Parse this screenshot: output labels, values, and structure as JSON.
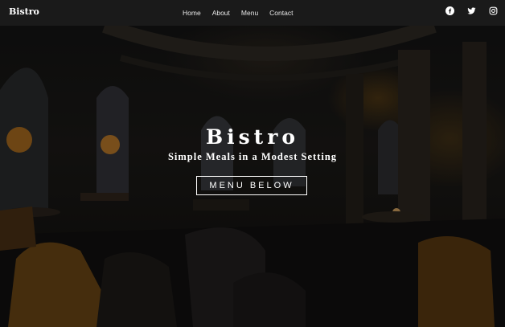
{
  "navbar": {
    "brand": "Bistro",
    "links": [
      {
        "label": "Home"
      },
      {
        "label": "About"
      },
      {
        "label": "Menu"
      },
      {
        "label": "Contact"
      }
    ],
    "social": [
      {
        "icon": "facebook-icon"
      },
      {
        "icon": "twitter-icon"
      },
      {
        "icon": "instagram-icon"
      }
    ]
  },
  "hero": {
    "title": "Bistro",
    "subtitle": "Simple Meals in a Modest Setting",
    "cta_label": "MENU BELOW"
  },
  "colors": {
    "navbar_bg": "#1a1a1a",
    "text": "#ffffff",
    "lamp_glow": "#c8861c"
  }
}
